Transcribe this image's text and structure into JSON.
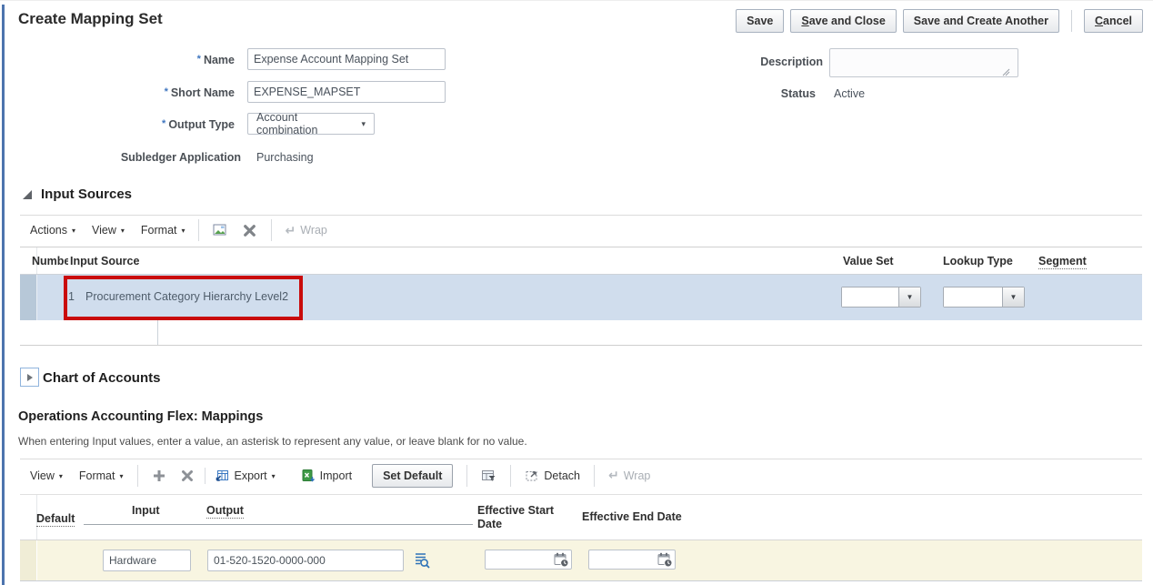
{
  "page": {
    "title": "Create Mapping Set"
  },
  "actions": {
    "save": "Save",
    "save_and_close": "Save and Close",
    "save_and_create_another": "Save and Create Another",
    "cancel": "Cancel"
  },
  "form": {
    "required_marker": "*",
    "name": {
      "label": "Name",
      "value": "Expense Account Mapping Set"
    },
    "short_name": {
      "label": "Short Name",
      "value": "EXPENSE_MAPSET"
    },
    "output_type": {
      "label": "Output Type",
      "value": "Account combination"
    },
    "subledger_application": {
      "label": "Subledger Application",
      "value": "Purchasing"
    },
    "description": {
      "label": "Description",
      "value": ""
    },
    "status": {
      "label": "Status",
      "value": "Active"
    }
  },
  "input_sources": {
    "title": "Input Sources",
    "toolbar": {
      "actions": "Actions",
      "view": "View",
      "format": "Format",
      "wrap": "Wrap"
    },
    "columns": {
      "number": "Numbe",
      "input_source": "Input Source",
      "value_set": "Value Set",
      "lookup_type": "Lookup Type",
      "segment": "Segment"
    },
    "rows": [
      {
        "number": "1",
        "input_source": "Procurement Category Hierarchy Level2",
        "value_set": "",
        "lookup_type": ""
      }
    ]
  },
  "chart_of_accounts": {
    "title": "Chart of Accounts"
  },
  "mappings": {
    "title": "Operations Accounting Flex: Mappings",
    "instruction": "When entering Input values, enter a value, an asterisk to represent any value, or leave blank for no value.",
    "toolbar": {
      "view": "View",
      "format": "Format",
      "export": "Export",
      "import": "Import",
      "set_default": "Set Default",
      "detach": "Detach",
      "wrap": "Wrap"
    },
    "columns": {
      "default": "Default",
      "input": "Input",
      "output": "Output",
      "effective_start_date": "Effective Start Date",
      "effective_end_date": "Effective End Date"
    },
    "rows": [
      {
        "input": "Hardware",
        "output": "01-520-1520-0000-000",
        "effective_start_date": "",
        "effective_end_date": ""
      }
    ]
  },
  "icons": {
    "caret_down": "▾",
    "wrap": "↵"
  },
  "colors": {
    "selected_row": "#d0dded",
    "row_selector": "#b7c8d8",
    "edit_row": "#f8f5e1",
    "annotation_red": "#c90b0b",
    "accent_blue": "#1a66b3",
    "left_border": "#4d74ae"
  }
}
